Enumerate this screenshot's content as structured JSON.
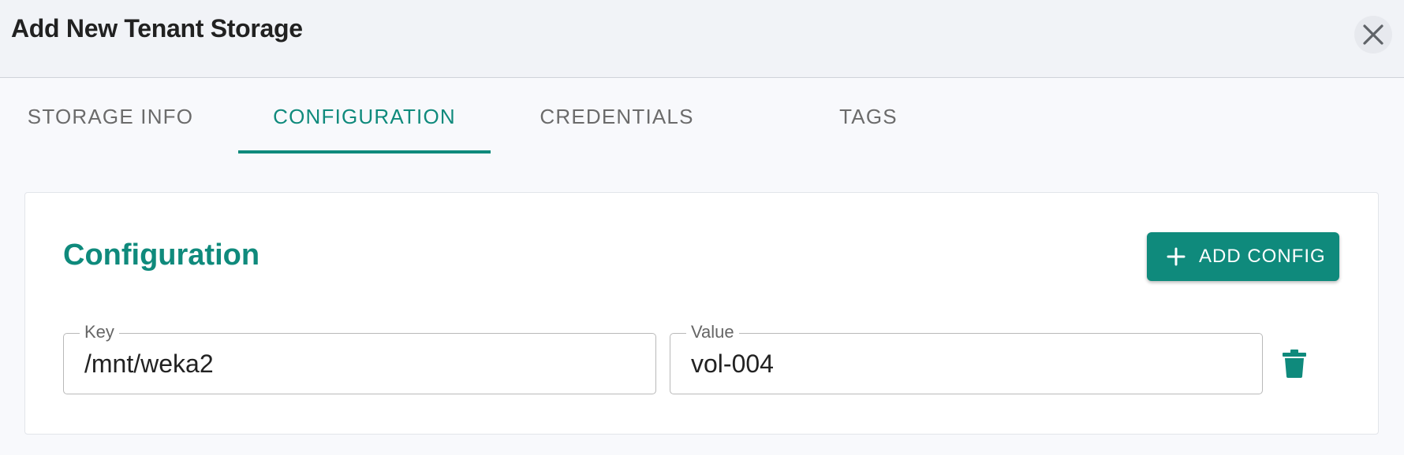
{
  "dialog": {
    "title": "Add New Tenant Storage"
  },
  "tabs": [
    {
      "label": "STORAGE INFO",
      "active": false
    },
    {
      "label": "CONFIGURATION",
      "active": true
    },
    {
      "label": "CREDENTIALS",
      "active": false
    },
    {
      "label": "TAGS",
      "active": false
    }
  ],
  "config_section": {
    "title": "Configuration",
    "add_button_label": "ADD CONFIG",
    "key_label": "Key",
    "value_label": "Value",
    "rows": [
      {
        "key": "/mnt/weka2",
        "value": "vol-004"
      }
    ]
  },
  "icons": {
    "close": "close-icon",
    "add": "plus-icon",
    "delete": "trash-icon"
  },
  "colors": {
    "accent": "#0f8a7c",
    "header_bg": "#f1f3f7",
    "page_bg": "#f8f9fc"
  }
}
